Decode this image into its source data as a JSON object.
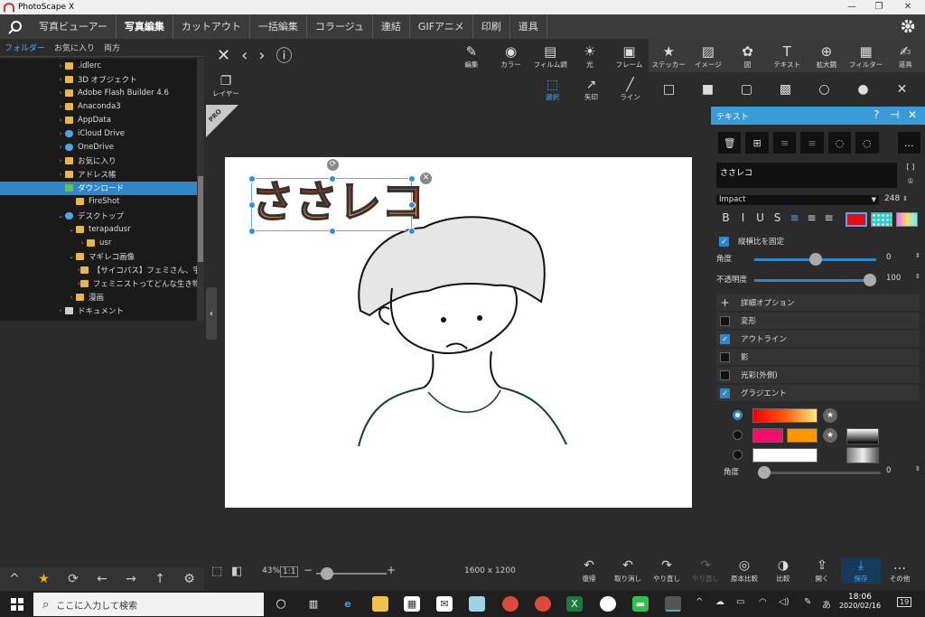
{
  "window": {
    "title": "PhotoScape X",
    "min": "—",
    "max": "❐",
    "close": "✕"
  },
  "menu": {
    "tabs": [
      "写真ビューアー",
      "写真編集",
      "カットアウト",
      "一括編集",
      "コラージュ",
      "連結",
      "GIFアニメ",
      "印刷",
      "道具"
    ],
    "active_index": 1
  },
  "left_panel": {
    "tabs": [
      "フォルダー",
      "お気に入り",
      "両方"
    ],
    "tree": [
      {
        "label": ".idlerc",
        "indent": 1,
        "arrow": "›",
        "icon": "folder"
      },
      {
        "label": "3D オブジェクト",
        "indent": 1,
        "arrow": "›",
        "icon": "folder"
      },
      {
        "label": "Adobe Flash Builder 4.6",
        "indent": 1,
        "arrow": "›",
        "icon": "folder"
      },
      {
        "label": "Anaconda3",
        "indent": 1,
        "arrow": "›",
        "icon": "folder"
      },
      {
        "label": "AppData",
        "indent": 1,
        "arrow": "›",
        "icon": "folder"
      },
      {
        "label": "iCloud Drive",
        "indent": 1,
        "arrow": "›",
        "icon": "cloud"
      },
      {
        "label": "OneDrive",
        "indent": 1,
        "arrow": "›",
        "icon": "cloud"
      },
      {
        "label": "お気に入り",
        "indent": 1,
        "arrow": "›",
        "icon": "folder"
      },
      {
        "label": "アドレス帳",
        "indent": 1,
        "arrow": "›",
        "icon": "folder"
      },
      {
        "label": "ダウンロード",
        "indent": 1,
        "arrow": "",
        "icon": "green",
        "selected": true
      },
      {
        "label": "FireShot",
        "indent": 2,
        "arrow": "",
        "icon": "folder"
      },
      {
        "label": "デスクトップ",
        "indent": 1,
        "arrow": "⌄",
        "icon": "blue"
      },
      {
        "label": "terapadusr",
        "indent": 2,
        "arrow": "⌄",
        "icon": "folder"
      },
      {
        "label": "usr",
        "indent": 3,
        "arrow": "›",
        "icon": "folder"
      },
      {
        "label": "マギレコ画像",
        "indent": 2,
        "arrow": "⌄",
        "icon": "folder"
      },
      {
        "label": "【サイコパス】フェミさん、宇崎ち",
        "indent": 3,
        "arrow": "›",
        "icon": "folder"
      },
      {
        "label": "フェミニストってどんな生き物？",
        "indent": 3,
        "arrow": "›",
        "icon": "folder"
      },
      {
        "label": "漫画",
        "indent": 2,
        "arrow": "›",
        "icon": "folder"
      },
      {
        "label": "ドキュメント",
        "indent": 1,
        "arrow": "›",
        "icon": "gray"
      }
    ],
    "bottom_icons": [
      "^",
      "★",
      "⟳",
      "←",
      "→",
      "↑",
      "⚙"
    ]
  },
  "toolbar": {
    "nav": [
      "✕",
      "‹",
      "›",
      "ⓘ"
    ],
    "categories": [
      {
        "label": "編集",
        "glyph": "✎"
      },
      {
        "label": "カラー",
        "glyph": "◉"
      },
      {
        "label": "フィルム調",
        "glyph": "▤"
      },
      {
        "label": "光",
        "glyph": "☀"
      },
      {
        "label": "フレーム",
        "glyph": "▣"
      },
      {
        "label": "ステッカー",
        "glyph": "★"
      },
      {
        "label": "イメージ",
        "glyph": "▨"
      },
      {
        "label": "図",
        "glyph": "✿"
      },
      {
        "label": "テキスト",
        "glyph": "T"
      },
      {
        "label": "拡大鏡",
        "glyph": "⊕"
      },
      {
        "label": "フィルター",
        "glyph": "▦"
      },
      {
        "label": "道具",
        "glyph": "✍"
      }
    ],
    "layer": {
      "label": "レイヤー",
      "glyph": "❐"
    },
    "shapes": [
      {
        "label": "選択",
        "glyph": "⬚",
        "active": true
      },
      {
        "label": "矢印",
        "glyph": "↗"
      },
      {
        "label": "ライン",
        "glyph": "╱"
      },
      {
        "label": "",
        "glyph": "□"
      },
      {
        "label": "",
        "glyph": "■"
      },
      {
        "label": "",
        "glyph": "▢"
      },
      {
        "label": "",
        "glyph": "▩"
      },
      {
        "label": "",
        "glyph": "○"
      },
      {
        "label": "",
        "glyph": "●"
      },
      {
        "label": "",
        "glyph": "✕"
      }
    ],
    "pro": "PRO"
  },
  "canvas": {
    "text": "ささレコ"
  },
  "text_panel": {
    "title": "テキスト",
    "header_icons": [
      "?",
      "⊣",
      "✕"
    ],
    "tools": [
      "🗑",
      "⊞",
      "≡",
      "≡",
      "◌",
      "◌",
      "…"
    ],
    "text_value": "ささレコ",
    "mini": [
      "[ ]",
      "①"
    ],
    "font": "Impact",
    "size": "248",
    "styles": [
      "B",
      "I",
      "U",
      "S"
    ],
    "aligns": [
      "≡",
      "≡",
      "≡"
    ],
    "fill_color": "#e01010",
    "keep_aspect": "縦横比を固定",
    "angle_label": "角度",
    "angle_value": "0",
    "opacity_label": "不透明度",
    "opacity_value": "100",
    "angle_fraction": 0.5,
    "opacity_fraction": 1.0,
    "sections": [
      {
        "label": "詳細オプション",
        "plus": true
      },
      {
        "label": "変形",
        "checked": false
      },
      {
        "label": "アウトライン",
        "checked": true
      },
      {
        "label": "影",
        "checked": false
      },
      {
        "label": "光彩(外側)",
        "checked": false
      },
      {
        "label": "グラジエント",
        "checked": true
      }
    ],
    "gradient_angle_label": "角度",
    "gradient_angle_value": "0"
  },
  "bottom": {
    "zoom": "43%",
    "ratio": "1:1",
    "dimensions": "1600 x 1200",
    "minus": "−",
    "plus": "+",
    "actions": [
      {
        "label": "復帰",
        "glyph": "↶"
      },
      {
        "label": "取り消し",
        "glyph": "↶"
      },
      {
        "label": "やり直し",
        "glyph": "↷"
      },
      {
        "label": "やり直し",
        "glyph": "↷",
        "dim": true
      },
      {
        "label": "原本比較",
        "glyph": "◎"
      },
      {
        "label": "比較",
        "glyph": "◑"
      },
      {
        "label": "開く",
        "glyph": "⇪"
      },
      {
        "label": "保存",
        "glyph": "⤓",
        "save": true
      },
      {
        "label": "その他",
        "glyph": "…"
      }
    ]
  },
  "taskbar": {
    "search_placeholder": "ここに入力して検索",
    "time": "18:06",
    "date": "2020/02/16",
    "notifications": "19"
  }
}
